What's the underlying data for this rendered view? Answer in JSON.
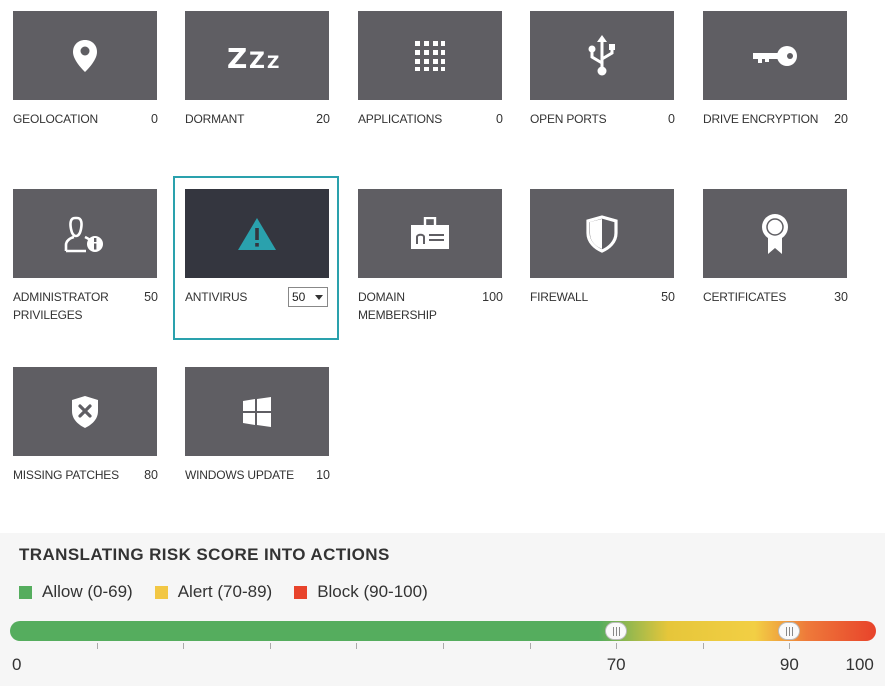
{
  "tiles": [
    {
      "label": "GEOLOCATION",
      "value": "0",
      "icon": "location-pin-icon"
    },
    {
      "label": "DORMANT",
      "value": "20",
      "icon": "sleep-zzz-icon"
    },
    {
      "label": "APPLICATIONS",
      "value": "0",
      "icon": "grid-dots-icon"
    },
    {
      "label": "OPEN PORTS",
      "value": "0",
      "icon": "usb-icon"
    },
    {
      "label": "DRIVE ENCRYPTION",
      "value": "20",
      "icon": "key-icon"
    },
    {
      "label": "ADMINISTRATOR PRIVILEGES",
      "value": "50",
      "icon": "admin-user-icon"
    },
    {
      "label": "ANTIVIRUS",
      "value": "50",
      "icon": "warning-icon"
    },
    {
      "label": "DOMAIN MEMBERSHIP",
      "value": "100",
      "icon": "id-badge-icon"
    },
    {
      "label": "FIREWALL",
      "value": "50",
      "icon": "shield-icon"
    },
    {
      "label": "CERTIFICATES",
      "value": "30",
      "icon": "award-ribbon-icon"
    },
    {
      "label": "MISSING PATCHES",
      "value": "80",
      "icon": "shield-x-icon"
    },
    {
      "label": "WINDOWS UPDATE",
      "value": "10",
      "icon": "windows-icon"
    }
  ],
  "antivirus_select": {
    "value": "50"
  },
  "risk": {
    "title": "TRANSLATING RISK SCORE INTO ACTIONS",
    "legend": [
      {
        "label": "Allow (0-69)",
        "color": "#55ad5e"
      },
      {
        "label": "Alert (70-89)",
        "color": "#f2c744"
      },
      {
        "label": "Block (90-100)",
        "color": "#e8432b"
      }
    ],
    "slider": {
      "min": 0,
      "max": 100,
      "handles": [
        70,
        90
      ]
    },
    "tick_labels": [
      "0",
      "70",
      "90",
      "100"
    ]
  }
}
